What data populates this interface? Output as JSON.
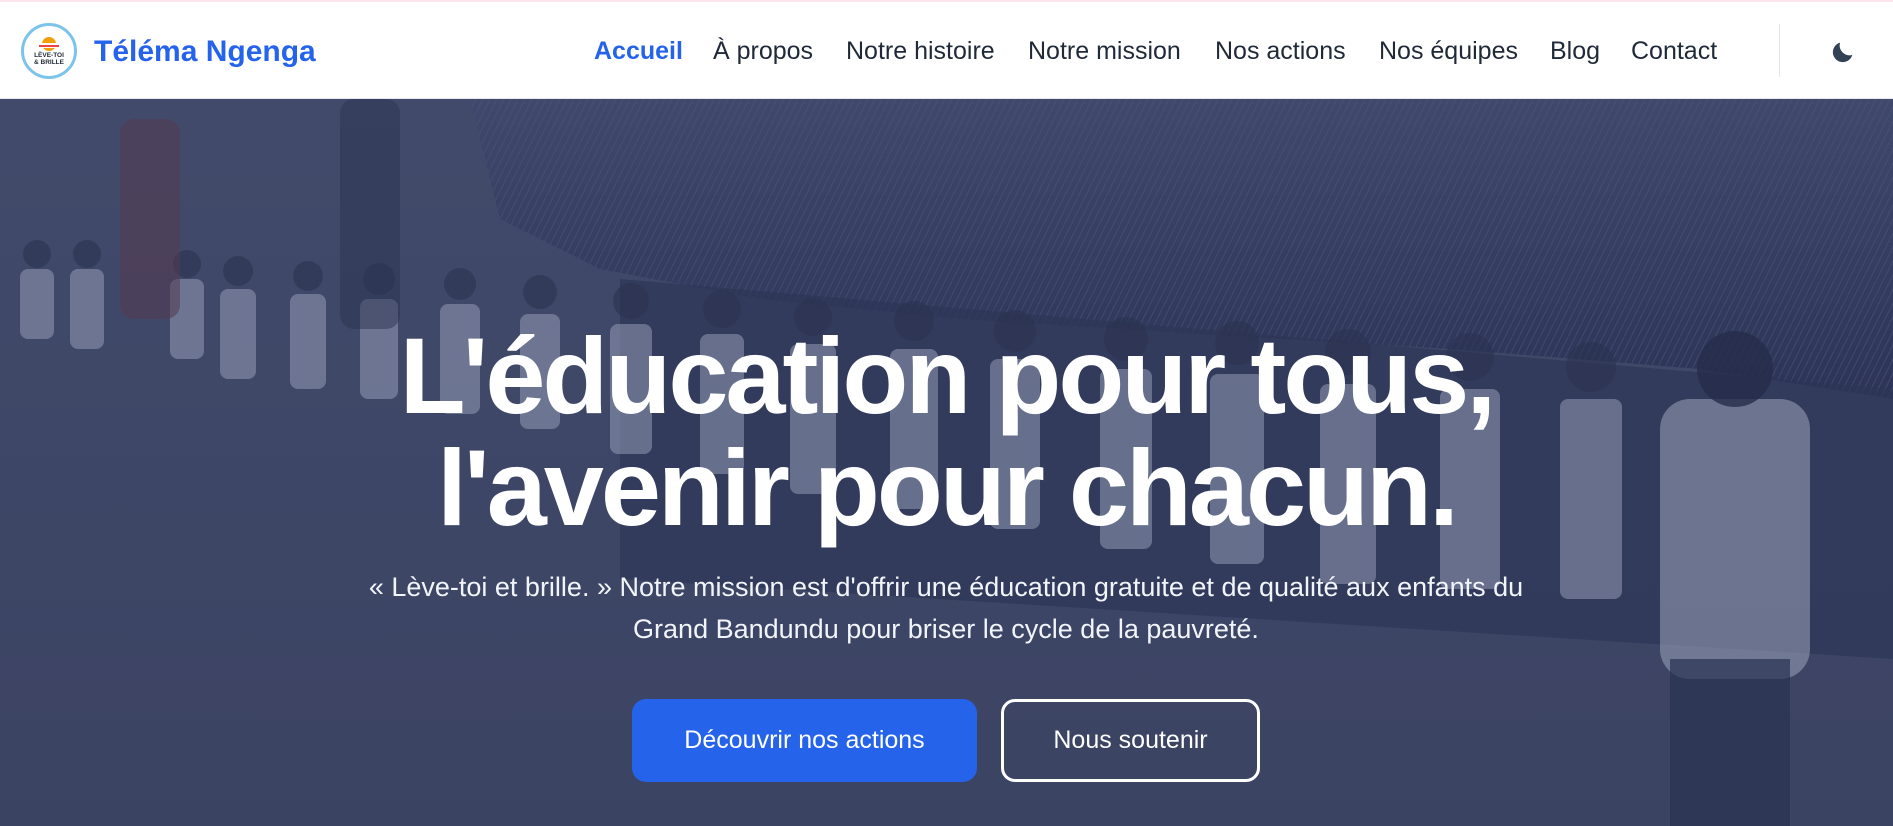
{
  "brand": {
    "name": "Téléma Ngenga"
  },
  "logo": {
    "text_top": "LÈVE-TOI",
    "text_bottom": "& BRILLE"
  },
  "nav": {
    "items": [
      {
        "label": "Accueil",
        "active": true
      },
      {
        "label": "À propos"
      },
      {
        "label": "Notre histoire"
      },
      {
        "label": "Notre mission"
      },
      {
        "label": "Nos actions"
      },
      {
        "label": "Nos équipes"
      },
      {
        "label": "Blog"
      },
      {
        "label": "Contact"
      }
    ]
  },
  "theme_toggle": {
    "icon": "moon-icon"
  },
  "hero": {
    "title_line1": "L'éducation pour tous,",
    "title_line2": "l'avenir pour chacun.",
    "text": "« Lève-toi et brille. » Notre mission est d'offrir une éducation gratuite et de qualité aux enfants du Grand Bandundu pour briser le cycle de la pauvreté.",
    "primary_button": "Découvrir nos actions",
    "secondary_button": "Nous soutenir"
  },
  "colors": {
    "accent": "#2563eb",
    "text_dark": "#1f2937",
    "hero_overlay": "#3b4469"
  }
}
